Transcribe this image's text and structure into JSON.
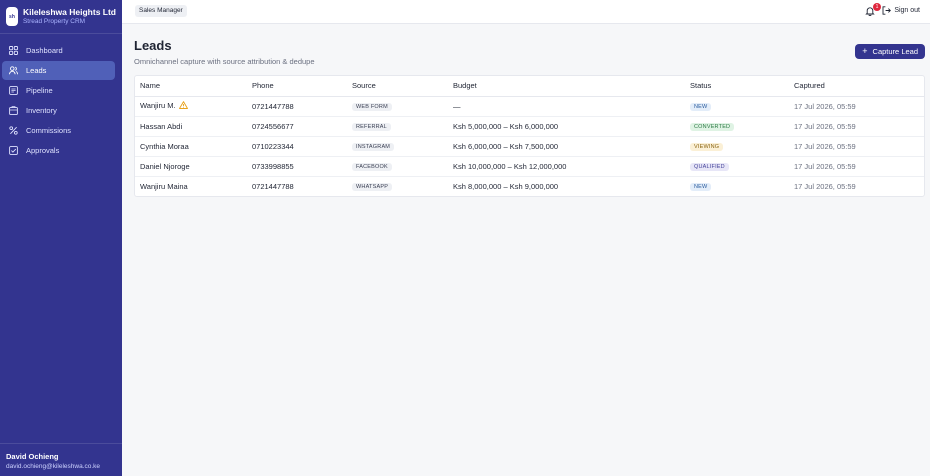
{
  "brand": {
    "name": "Kileleshwa Heights Ltd",
    "subtitle": "Stread Property CRM",
    "logo_text": "sh"
  },
  "sidebar": {
    "items": [
      {
        "label": "Dashboard",
        "icon": "grid-icon",
        "active": false
      },
      {
        "label": "Leads",
        "icon": "users-icon",
        "active": true
      },
      {
        "label": "Pipeline",
        "icon": "pipeline-icon",
        "active": false
      },
      {
        "label": "Inventory",
        "icon": "building-icon",
        "active": false
      },
      {
        "label": "Commissions",
        "icon": "percent-icon",
        "active": false
      },
      {
        "label": "Approvals",
        "icon": "check-square-icon",
        "active": false
      }
    ]
  },
  "user": {
    "name": "David Ochieng",
    "email": "david.ochieng@kileleshwa.co.ke"
  },
  "topbar": {
    "role": "Sales Manager",
    "notification_count": "1",
    "signout_label": "Sign out"
  },
  "page": {
    "title": "Leads",
    "subtitle": "Omnichannel capture with source attribution & dedupe",
    "capture_button": "Capture Lead"
  },
  "table": {
    "headers": [
      "Name",
      "Phone",
      "Source",
      "Budget",
      "Status",
      "Captured"
    ],
    "rows": [
      {
        "name": "Wanjiru M.",
        "warning": true,
        "phone": "0721447788",
        "source": "WEB FORM",
        "budget": "—",
        "status": "NEW",
        "captured": "17 Jul 2026, 05:59"
      },
      {
        "name": "Hassan Abdi",
        "warning": false,
        "phone": "0724556677",
        "source": "REFERRAL",
        "budget": "Ksh 5,000,000 – Ksh 6,000,000",
        "status": "CONVERTED",
        "captured": "17 Jul 2026, 05:59"
      },
      {
        "name": "Cynthia Moraa",
        "warning": false,
        "phone": "0710223344",
        "source": "INSTAGRAM",
        "budget": "Ksh 6,000,000 – Ksh 7,500,000",
        "status": "VIEWING",
        "captured": "17 Jul 2026, 05:59"
      },
      {
        "name": "Daniel Njoroge",
        "warning": false,
        "phone": "0733998855",
        "source": "FACEBOOK",
        "budget": "Ksh 10,000,000 – Ksh 12,000,000",
        "status": "QUALIFIED",
        "captured": "17 Jul 2026, 05:59"
      },
      {
        "name": "Wanjiru Maina",
        "warning": false,
        "phone": "0721447788",
        "source": "WHATSAPP",
        "budget": "Ksh 8,000,000 – Ksh 9,000,000",
        "status": "NEW",
        "captured": "17 Jul 2026, 05:59"
      }
    ]
  },
  "colors": {
    "sidebar": "#33348f",
    "accent": "#33348f",
    "status_new_bg": "#e3edf9",
    "status_new_fg": "#2b5c9e",
    "status_converted_bg": "#dff3e4",
    "status_converted_fg": "#2c7a44",
    "status_viewing_bg": "#fbf0d6",
    "status_viewing_fg": "#8a6412",
    "status_qualified_bg": "#e7e6f7",
    "status_qualified_fg": "#46449a",
    "warning": "#e8a21b"
  }
}
